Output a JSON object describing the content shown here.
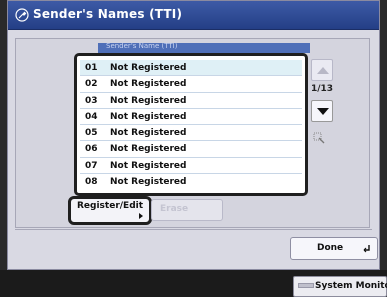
{
  "title_bar": {
    "title": "Sender's Names (TTI)",
    "icon": "wrench-icon"
  },
  "list": {
    "header_label": "Sender's Name (TTI)",
    "rows": [
      {
        "number": "01",
        "name": "Not Registered",
        "selected": true
      },
      {
        "number": "02",
        "name": "Not Registered",
        "selected": false
      },
      {
        "number": "03",
        "name": "Not Registered",
        "selected": false
      },
      {
        "number": "04",
        "name": "Not Registered",
        "selected": false
      },
      {
        "number": "05",
        "name": "Not Registered",
        "selected": false
      },
      {
        "number": "06",
        "name": "Not Registered",
        "selected": false
      },
      {
        "number": "07",
        "name": "Not Registered",
        "selected": false
      },
      {
        "number": "08",
        "name": "Not Registered",
        "selected": false
      }
    ]
  },
  "pagination": {
    "current": "1/13"
  },
  "buttons": {
    "register_edit": "Register/Edit",
    "erase": "Erase",
    "done": "Done",
    "system_monitor": "System Monitor"
  },
  "colors": {
    "title_bar": "#2f4c99",
    "selected_row": "#dff0f6",
    "panel_bg": "#d9d9e3"
  }
}
